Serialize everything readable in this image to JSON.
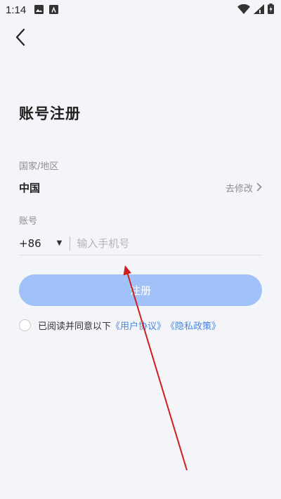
{
  "status_bar": {
    "time": "1:14"
  },
  "page": {
    "title": "账号注册"
  },
  "region": {
    "label": "国家/地区",
    "value": "中国",
    "change_label": "去修改"
  },
  "account": {
    "label": "账号",
    "country_code": "+86",
    "phone_placeholder": "输入手机号"
  },
  "register_button": {
    "label": "注册"
  },
  "agreement": {
    "prefix": "已阅读并同意以下",
    "user_agreement": "《用户协议》",
    "privacy_policy": "《隐私政策》"
  },
  "colors": {
    "primary_disabled": "#a0c2f8",
    "link": "#4a86e0",
    "annotation_arrow": "#cc1f1f",
    "background": "#f4f5f9"
  }
}
